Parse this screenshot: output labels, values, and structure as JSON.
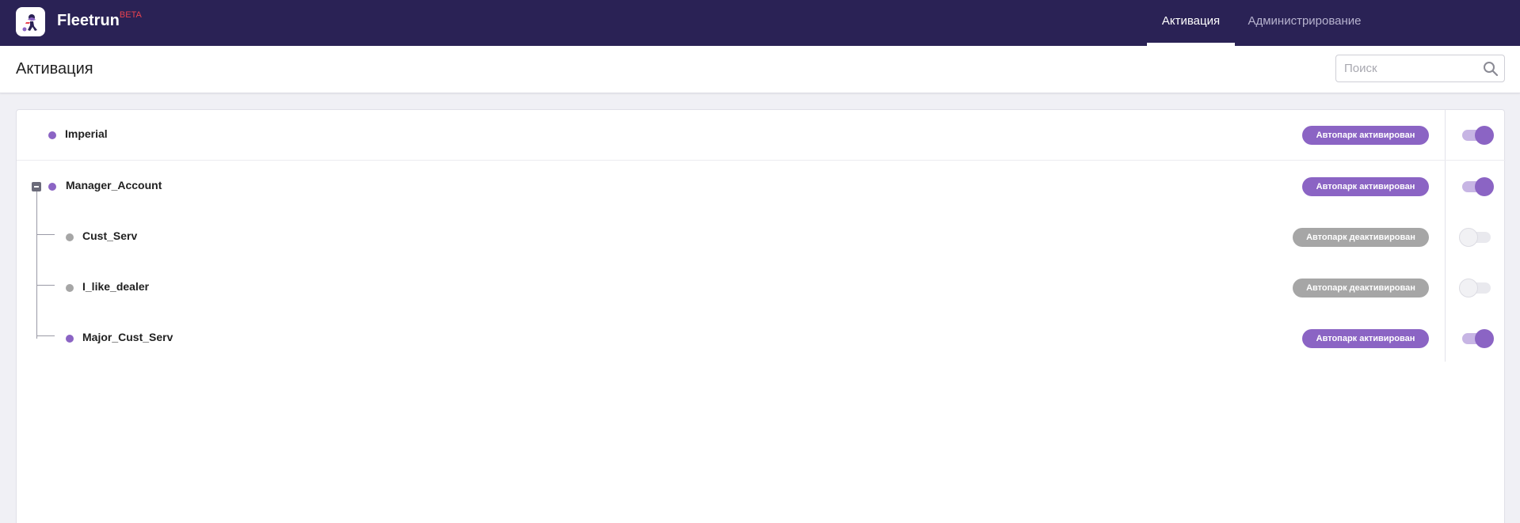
{
  "header": {
    "brand": "Fleetrun",
    "beta": "BETA",
    "tabs": [
      {
        "label": "Активация",
        "active": true
      },
      {
        "label": "Администрирование",
        "active": false
      }
    ]
  },
  "page": {
    "title": "Активация",
    "search_placeholder": "Поиск"
  },
  "colors": {
    "topbar": "#2a2255",
    "accent": "#8b64c4",
    "inactive": "#a6a6a6",
    "beta": "#e8424f"
  },
  "accounts": [
    {
      "name": "Imperial",
      "status": "Автопарк активирован",
      "active": true,
      "level": 0
    },
    {
      "name": "Manager_Account",
      "status": "Автопарк активирован",
      "active": true,
      "level": 0,
      "expanded": true
    },
    {
      "name": "Cust_Serv",
      "status": "Автопарк деактивирован",
      "active": false,
      "level": 1
    },
    {
      "name": "I_like_dealer",
      "status": "Автопарк деактивирован",
      "active": false,
      "level": 1
    },
    {
      "name": "Major_Cust_Serv",
      "status": "Автопарк активирован",
      "active": true,
      "level": 1
    }
  ]
}
